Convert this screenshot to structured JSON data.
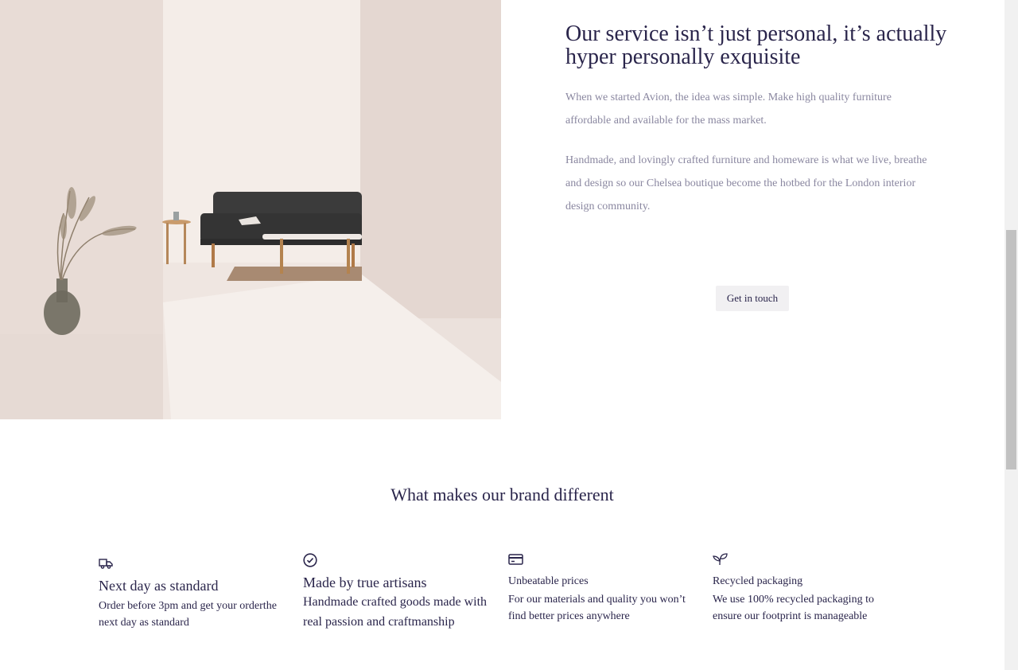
{
  "about": {
    "heading": "Our service isn’t just personal, it’s actually hyper personally exquisite",
    "paragraph_1": "When we started Avion, the idea was simple. Make high quality furniture affordable and available for the mass market.",
    "paragraph_2": "Handmade, and lovingly crafted furniture and homeware is what we live, breathe and design so our Chelsea boutique become the hotbed for the London interior design community.",
    "cta_label": "Get in touch"
  },
  "features": {
    "title": "What makes our brand different",
    "items": [
      {
        "icon": "delivery-truck-icon",
        "title": "Next day as standard",
        "text": "Order before 3pm and get your orderthe next day as standard"
      },
      {
        "icon": "check-circle-icon",
        "title": "Made by true artisans",
        "text": "Handmade crafted goods made with real passion and craftmanship"
      },
      {
        "icon": "credit-card-icon",
        "title": "Unbeatable prices",
        "text": "For our materials and quality you won’t find better prices anywhere"
      },
      {
        "icon": "leaf-sprout-icon",
        "title": "Recycled packaging",
        "text": "We use 100% recycled packaging to ensure our footprint is manageable"
      }
    ]
  },
  "colors": {
    "primary_text": "#2a254b",
    "muted_text": "#8a87a0",
    "button_bg": "#f1f0f2"
  }
}
